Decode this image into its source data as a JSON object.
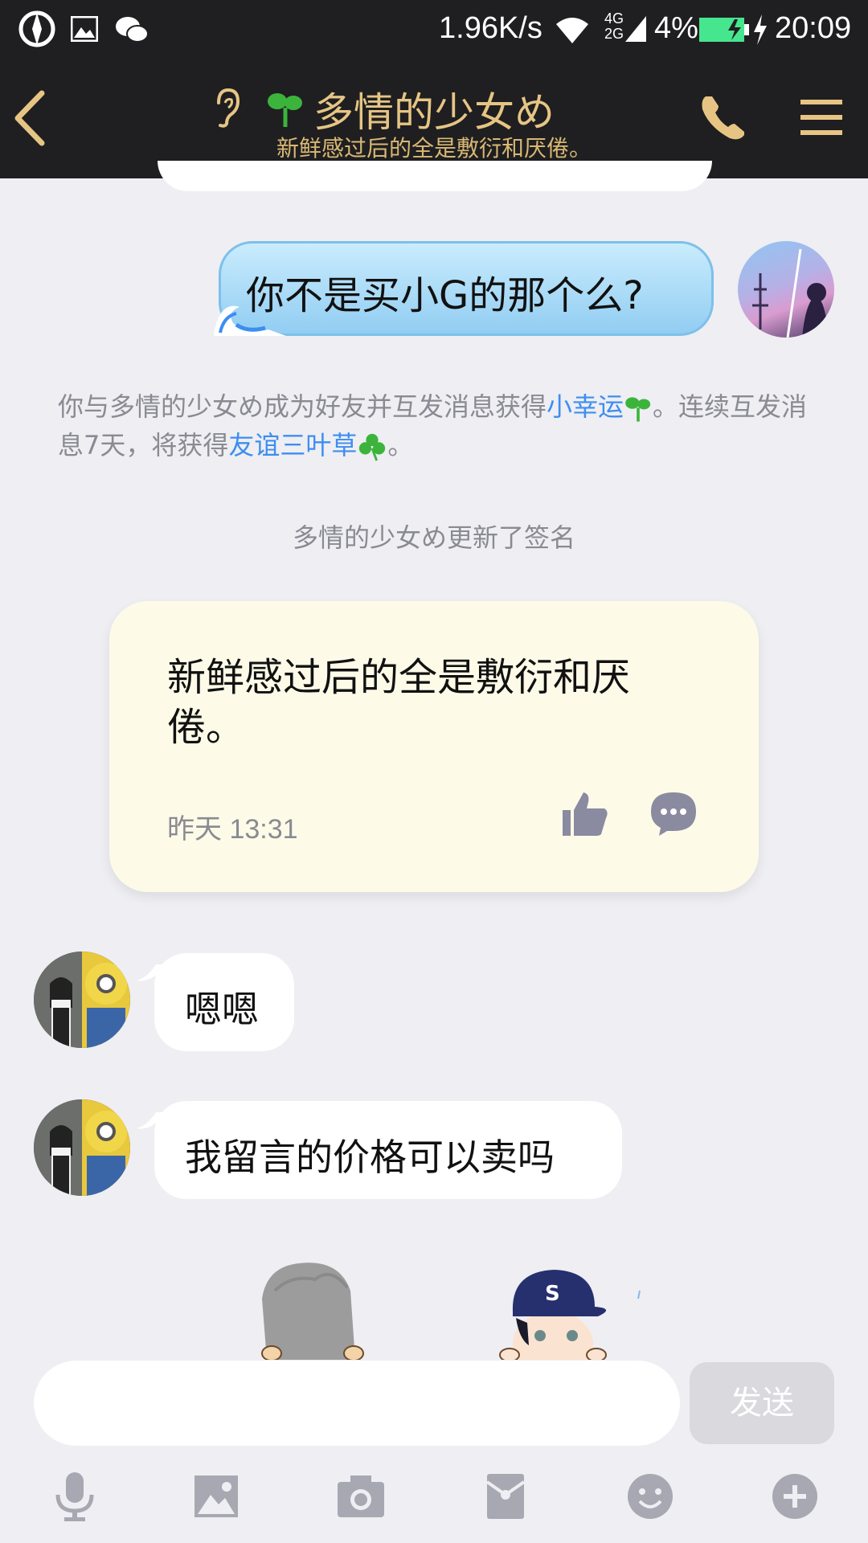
{
  "status_bar": {
    "speed": "1.96K/s",
    "network": "4G",
    "network2": "2G",
    "battery": "4%",
    "time": "20:09"
  },
  "header": {
    "title": "多情的少女め",
    "subtitle": "新鲜感过后的全是敷衍和厌倦。"
  },
  "messages": {
    "sent_1": "你不是买小G的那个么?",
    "system_1": {
      "prefix": "你与多情的少女め成为好友并互发消息获得",
      "link1": "小幸运",
      "mid": "。连续互发消息7天，将获得",
      "link2": "友谊三叶草",
      "suffix": "。"
    },
    "system_2": "多情的少女め更新了签名",
    "signature": {
      "text": "新鲜感过后的全是敷衍和厌倦。",
      "time": "昨天 13:31"
    },
    "received_1": "嗯嗯",
    "received_2": "我留言的价格可以卖吗"
  },
  "input": {
    "placeholder": "",
    "send_label": "发送"
  },
  "icons": [
    "back-icon",
    "ear-icon",
    "sprout-icon",
    "phone-icon",
    "menu-icon",
    "like-icon",
    "comment-icon",
    "mic-icon",
    "image-icon",
    "camera-icon",
    "red-packet-icon",
    "emoji-icon",
    "plus-icon"
  ],
  "colors": {
    "header_bg": "#1f1f21",
    "accent_gold": "#e6c584",
    "link_blue": "#3d8ef0",
    "sent_bubble": "#a9d9f7",
    "signature_card": "#fdfbe8"
  }
}
